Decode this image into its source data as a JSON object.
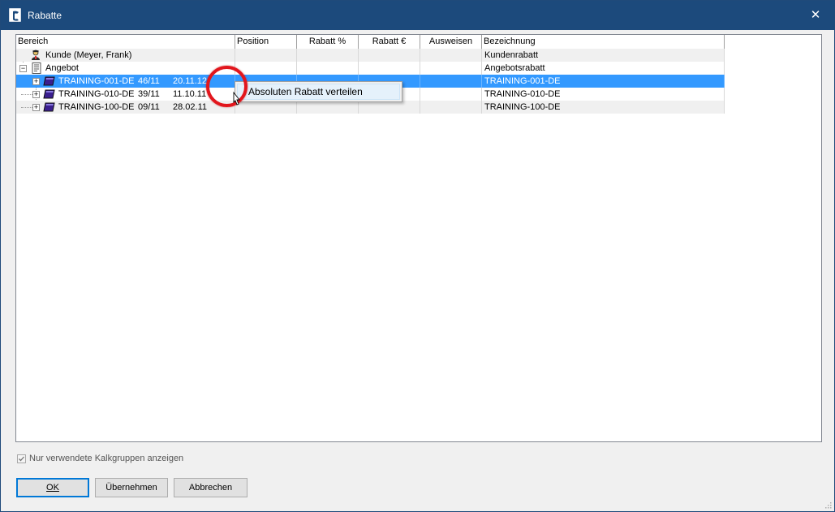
{
  "window": {
    "title": "Rabatte",
    "close_glyph": "✕"
  },
  "columns": [
    "Bereich",
    "Position",
    "Rabatt %",
    "Rabatt €",
    "Ausweisen",
    "Bezeichnung"
  ],
  "rows": [
    {
      "bereich": "Kunde (Meyer, Frank)",
      "bezeichnung": "Kundenrabatt",
      "icon": "person-icon"
    },
    {
      "bereich": "Angebot",
      "bezeichnung": "Angebotsrabatt",
      "icon": "document-icon"
    },
    {
      "code": "TRAINING-001-DE",
      "pos": "46/11",
      "date": "20.11.12",
      "bezeichnung": "TRAINING-001-DE",
      "icon": "book-icon",
      "selected": true
    },
    {
      "code": "TRAINING-010-DE",
      "pos": "39/11",
      "date": "11.10.11",
      "bezeichnung": "TRAINING-010-DE",
      "icon": "book-icon"
    },
    {
      "code": "TRAINING-100-DE",
      "pos": "09/11",
      "date": "28.02.11",
      "bezeichnung": "TRAINING-100-DE",
      "icon": "book-icon"
    }
  ],
  "context_menu": {
    "item": "Absoluten Rabatt verteilen"
  },
  "checkbox": {
    "label": "Nur verwendete Kalkgruppen anzeigen",
    "checked": true
  },
  "buttons": {
    "ok": "OK",
    "apply": "Übernehmen",
    "cancel": "Abbrechen"
  },
  "colors": {
    "titlebar": "#1c4a7c",
    "selection": "#3399ff",
    "highlight": "#e2161d"
  }
}
